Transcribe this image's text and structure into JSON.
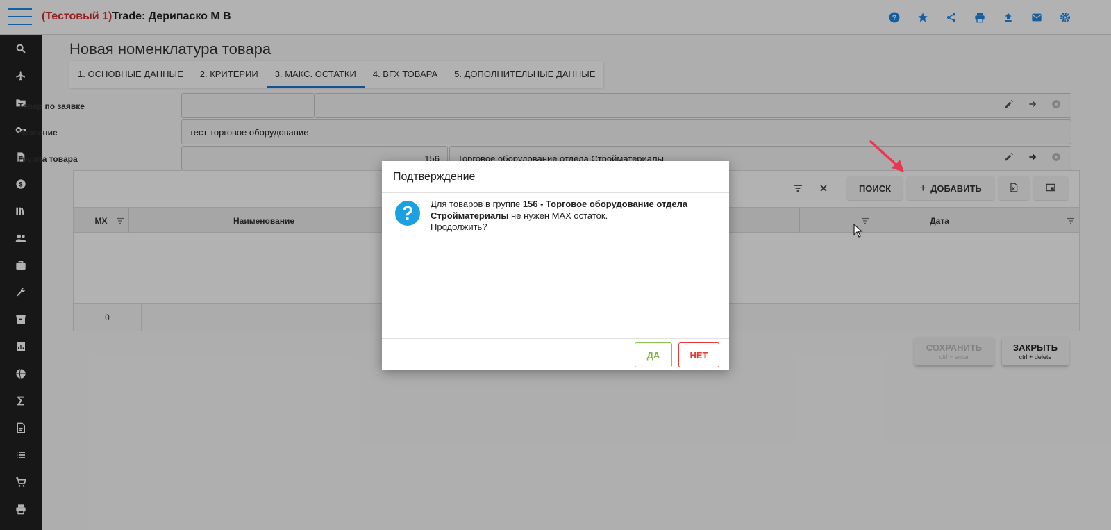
{
  "header": {
    "title_test": "(Тестовый 1)",
    "title_main": "Trade: Дерипаско М В",
    "icons": [
      "help-icon",
      "star-icon",
      "share-icon",
      "print-icon",
      "upload-icon",
      "mail-icon",
      "settings-icon"
    ],
    "accent_color": "#1e88e5"
  },
  "sidebar": {
    "items": [
      "search-icon",
      "airplane-icon",
      "folder-icon",
      "key-icon",
      "document-icon",
      "dollar-icon",
      "library-icon",
      "people-icon",
      "briefcase-icon",
      "wrench-icon",
      "box-icon",
      "chart-icon",
      "globe-icon",
      "sigma-icon",
      "file-icon",
      "list-icon",
      "cart-icon",
      "printer-icon"
    ]
  },
  "page": {
    "title": "Новая номенклатура товара",
    "tabs": [
      {
        "label": "1. ОСНОВНЫЕ ДАННЫЕ"
      },
      {
        "label": "2. КРИТЕРИИ"
      },
      {
        "label": "3. МАКС. ОСТАТКИ"
      },
      {
        "label": "4. ВГХ ТОВАРА"
      },
      {
        "label": "5. ДОПОЛНИТЕЛЬНЫЕ ДАННЫЕ"
      }
    ],
    "active_tab": "3. МАКС. ОСТАТКИ"
  },
  "form": {
    "order_item_label": "Товар по заявке",
    "order_item_code": "",
    "order_item_name": "",
    "name_label": "Название",
    "name_value": "тест торговое оборудование",
    "group_label": "Группа товара",
    "group_code": "156",
    "group_name": "Торговое оборудование отдела Стройматериалы"
  },
  "grid": {
    "search_label": "ПОИСК",
    "add_label": "ДОБАВИТЬ",
    "columns": [
      "МХ",
      "Наименование",
      "",
      "Дата"
    ],
    "row_count": "0"
  },
  "actions": {
    "save_label": "СОХРАНИТЬ",
    "save_hint": "ctrl + enter",
    "close_label": "ЗАКРЫТЬ",
    "close_hint": "ctrl + delete"
  },
  "dialog": {
    "title": "Подтверждение",
    "msg_prefix": "Для товаров в группе ",
    "msg_group": "156 - Торговое оборудование отдела Стройматериалы",
    "msg_suffix": " не нужен MAX остаток.",
    "msg_question": "Продолжить?",
    "yes_label": "ДА",
    "no_label": "НЕТ"
  }
}
